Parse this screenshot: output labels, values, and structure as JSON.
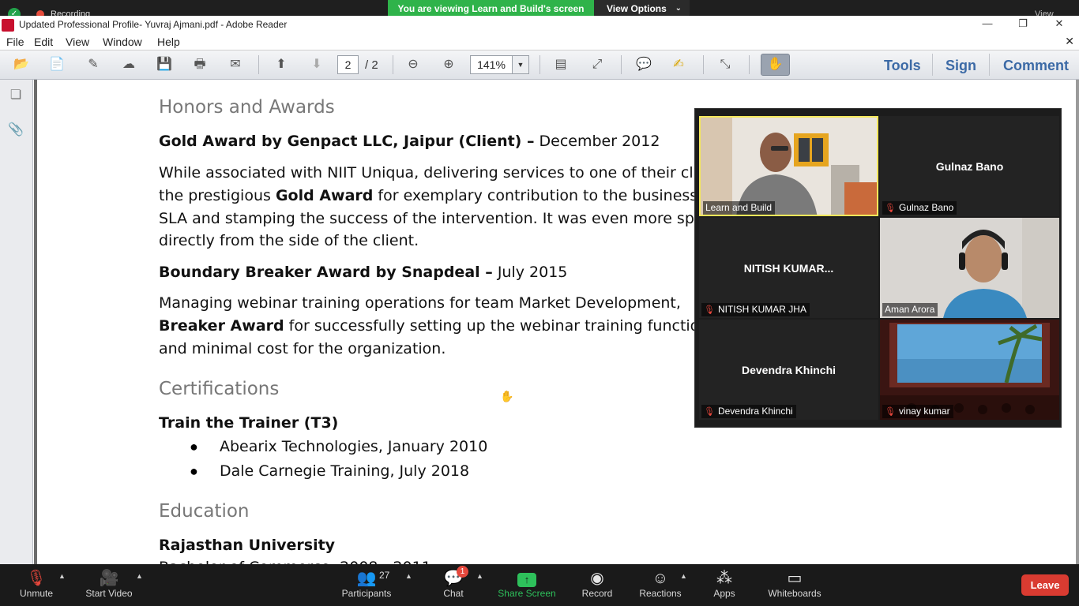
{
  "zoom_top": {
    "recording_label": "Recording",
    "viewing_banner": "You are viewing Learn and Build's screen",
    "view_options": "View Options",
    "view_label": "View"
  },
  "window": {
    "title": "Updated Professional Profile- Yuvraj Ajmani.pdf - Adobe Reader"
  },
  "menu": [
    "File",
    "Edit",
    "View",
    "Window",
    "Help"
  ],
  "toolbar": {
    "page_current": "2",
    "page_total": "/ 2",
    "zoom": "141%",
    "tools": "Tools",
    "sign": "Sign",
    "comment": "Comment"
  },
  "document": {
    "honors_heading": "Honors and Awards",
    "gold_title": "Gold Award by Genpact LLC, Jaipur (Client) –",
    "gold_date": " December 2012",
    "gold_p1": "While associated with NIIT Uniqua, delivering services to one of their cl",
    "gold_p2a": "the prestigious ",
    "gold_p2b": "Gold Award",
    "gold_p2c": " for exemplary contribution to the business",
    "gold_p3": "SLA and stamping the success of the intervention. It was even more spe",
    "gold_p4": "directly from the side of the client.",
    "boundary_title": "Boundary Breaker Award by Snapdeal –",
    "boundary_date": " July 2015",
    "boundary_p1": "Managing webinar training operations for team Market Development,",
    "boundary_p2a": "Breaker Award",
    "boundary_p2b": " for successfully setting up the webinar training functio",
    "boundary_p3": "and minimal cost for the organization.",
    "cert_heading": "Certifications",
    "cert_title": "Train the Trainer (T3)",
    "cert_items": [
      "Abearix Technologies, January 2010",
      "Dale Carnegie Training, July 2018"
    ],
    "edu_heading": "Education",
    "edu_title": "Rajasthan University",
    "edu_partial": "Bachelor of Commerce, 2008 - 2011"
  },
  "gallery": {
    "tiles": [
      {
        "name": "Learn and Build",
        "label": "Learn and Build",
        "muted": false,
        "video": true
      },
      {
        "name": "Gulnaz Bano",
        "label": "Gulnaz Bano",
        "muted": true,
        "video": false
      },
      {
        "name": "NITISH KUMAR...",
        "label": "NITISH KUMAR JHA",
        "muted": true,
        "video": false
      },
      {
        "name": "Aman Arora",
        "label": "Aman Arora",
        "muted": false,
        "video": true
      },
      {
        "name": "Devendra Khinchi",
        "label": "Devendra Khinchi",
        "muted": true,
        "video": false
      },
      {
        "name": "vinay kumar",
        "label": "vinay kumar",
        "muted": true,
        "video": true
      }
    ]
  },
  "controls": {
    "unmute": "Unmute",
    "start_video": "Start Video",
    "participants": "Participants",
    "participants_count": "27",
    "chat": "Chat",
    "chat_badge": "1",
    "share_screen": "Share Screen",
    "record": "Record",
    "reactions": "Reactions",
    "apps": "Apps",
    "whiteboards": "Whiteboards",
    "leave": "Leave"
  },
  "colors": {
    "zoom_green": "#2fb34a",
    "leave_red": "#d93b31",
    "adobe_blue": "#3c6aa6"
  }
}
